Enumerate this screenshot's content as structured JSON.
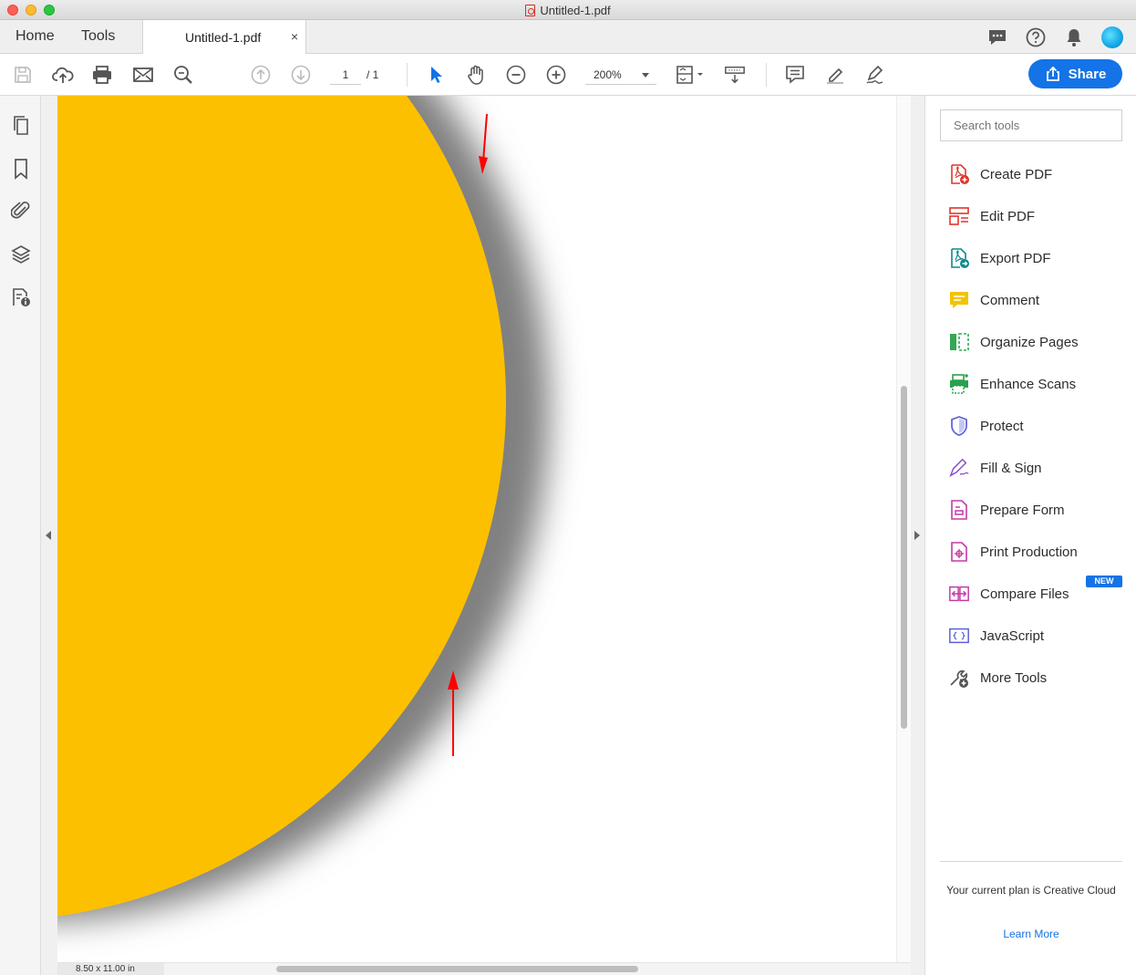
{
  "window": {
    "title": "Untitled-1.pdf"
  },
  "tabs": {
    "home": "Home",
    "tools": "Tools",
    "document": "Untitled-1.pdf",
    "close": "×"
  },
  "toolbar": {
    "page_current": "1",
    "page_total": "/ 1",
    "zoom": "200%",
    "share": "Share"
  },
  "document": {
    "page_size": "8.50 x 11.00 in",
    "colors": {
      "circle": "#fcc000",
      "shadow": "#808080",
      "arrow": "#ff0000"
    }
  },
  "right_panel": {
    "search_placeholder": "Search tools",
    "tools": [
      {
        "label": "Create PDF",
        "icon": "create-pdf-icon",
        "color": "#e0352b"
      },
      {
        "label": "Edit PDF",
        "icon": "edit-pdf-icon",
        "color": "#e0352b"
      },
      {
        "label": "Export PDF",
        "icon": "export-pdf-icon",
        "color": "#0d8a8a"
      },
      {
        "label": "Comment",
        "icon": "comment-icon",
        "color": "#f2c400"
      },
      {
        "label": "Organize Pages",
        "icon": "organize-pages-icon",
        "color": "#33a853"
      },
      {
        "label": "Enhance Scans",
        "icon": "enhance-scans-icon",
        "color": "#2ba14a"
      },
      {
        "label": "Protect",
        "icon": "protect-icon",
        "color": "#5b5fd6"
      },
      {
        "label": "Fill & Sign",
        "icon": "fill-sign-icon",
        "color": "#8a4fd1"
      },
      {
        "label": "Prepare Form",
        "icon": "prepare-form-icon",
        "color": "#c33aa6"
      },
      {
        "label": "Print Production",
        "icon": "print-production-icon",
        "color": "#c33aa6"
      },
      {
        "label": "Compare Files",
        "icon": "compare-files-icon",
        "color": "#c33aa6"
      },
      {
        "label": "JavaScript",
        "icon": "javascript-icon",
        "color": "#5b5fd6"
      },
      {
        "label": "More Tools",
        "icon": "more-tools-icon",
        "color": "#555555"
      }
    ],
    "new_badge": "NEW",
    "plan_text": "Your current plan is Creative Cloud",
    "learn_more": "Learn More"
  }
}
